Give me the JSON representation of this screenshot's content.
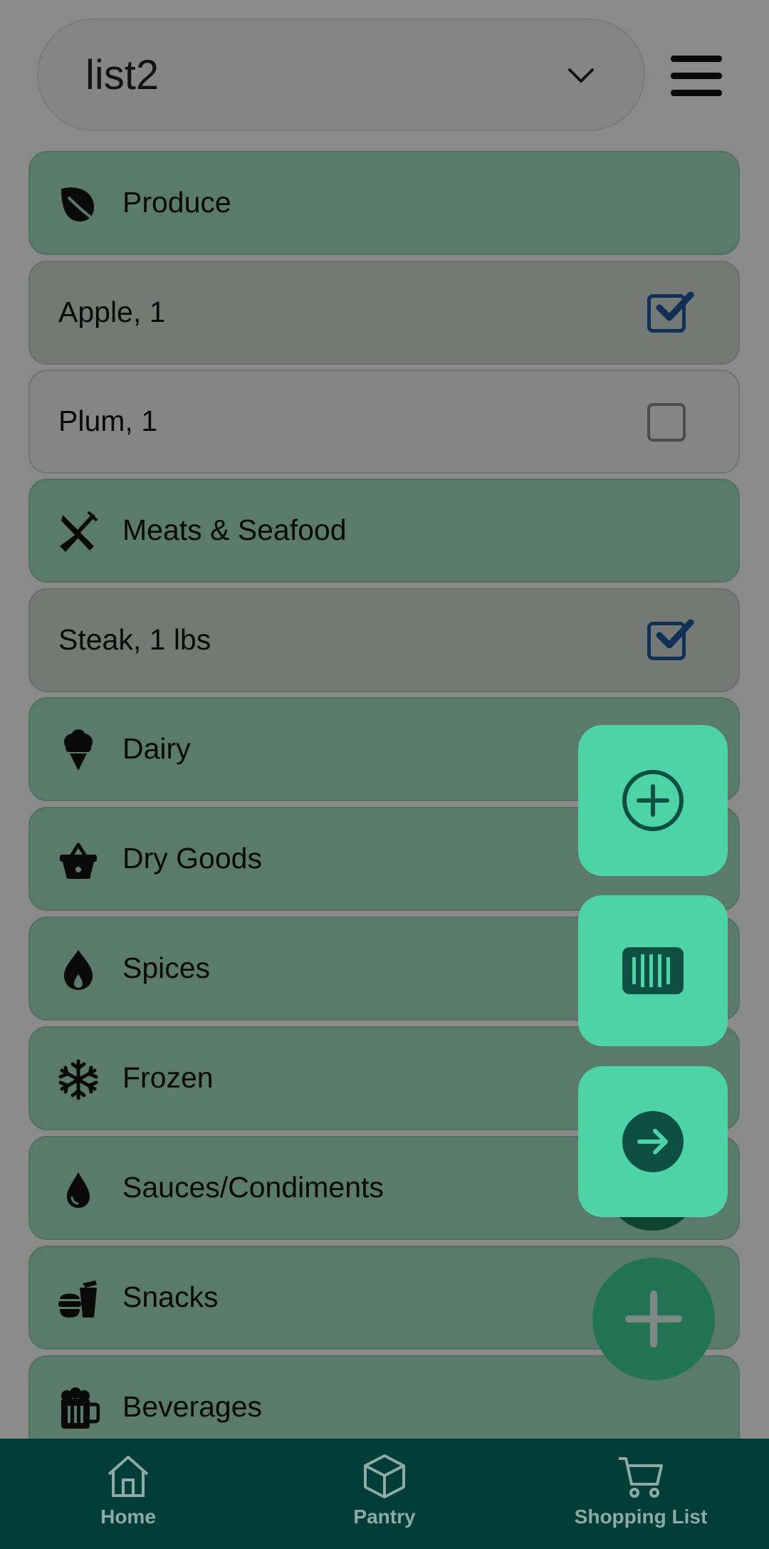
{
  "header": {
    "list_selector": {
      "value": "list2"
    }
  },
  "list": {
    "rows": [
      {
        "kind": "category",
        "label": "Produce",
        "icon": "leaf-icon"
      },
      {
        "kind": "item",
        "label": "Apple, 1",
        "checked": true
      },
      {
        "kind": "item",
        "label": "Plum, 1",
        "checked": false
      },
      {
        "kind": "category",
        "label": "Meats & Seafood",
        "icon": "utensils-icon"
      },
      {
        "kind": "item",
        "label": "Steak, 1 lbs",
        "checked": true
      },
      {
        "kind": "category",
        "label": "Dairy",
        "icon": "ice-cream-icon"
      },
      {
        "kind": "category",
        "label": "Dry Goods",
        "icon": "basket-icon"
      },
      {
        "kind": "category",
        "label": "Spices",
        "icon": "fire-drop-icon"
      },
      {
        "kind": "category",
        "label": "Frozen",
        "icon": "snowflake-icon"
      },
      {
        "kind": "category",
        "label": "Sauces/Condiments",
        "icon": "droplet-icon"
      },
      {
        "kind": "category",
        "label": "Snacks",
        "icon": "snack-icon"
      },
      {
        "kind": "category",
        "label": "Beverages",
        "icon": "beer-mug-icon"
      }
    ]
  },
  "fab": {
    "actions": [
      {
        "icon": "add-circle-icon"
      },
      {
        "icon": "barcode-icon"
      },
      {
        "icon": "arrow-right-circle-icon"
      }
    ],
    "main_icon": "plus-icon"
  },
  "bottom_nav": {
    "items": [
      {
        "label": "Home",
        "icon": "home-icon"
      },
      {
        "label": "Pantry",
        "icon": "box-icon"
      },
      {
        "label": "Shopping List",
        "icon": "cart-icon"
      }
    ]
  },
  "colors": {
    "category_bg": "#a5dfc4",
    "checked_item_bg": "#d6dcd6",
    "fab_bg": "#4dd3a5",
    "nav_bg": "#003d38",
    "checkbox_blue": "#1e5a9c"
  }
}
